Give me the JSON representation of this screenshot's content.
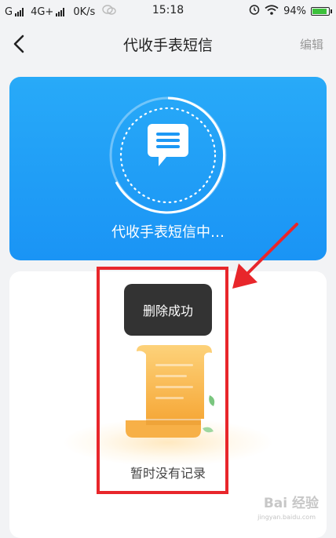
{
  "status_bar": {
    "carrier1": "G",
    "carrier2": "4G+",
    "speed": "0K/s",
    "time": "15:18",
    "battery": "94%",
    "battery_level": 0.94
  },
  "navbar": {
    "title": "代收手表短信",
    "edit_label": "编辑",
    "back_icon": "chevron-left-icon"
  },
  "hero": {
    "status_text": "代收手表短信中…",
    "icon": "message-icon",
    "color_top": "#28aaf8",
    "color_bottom": "#1a94f5"
  },
  "empty_state": {
    "text": "暂时没有记录",
    "icon": "empty-scroll-icon"
  },
  "toast": {
    "text": "删除成功"
  },
  "annotation": {
    "highlight_color": "#e8262b"
  },
  "watermark": {
    "text": "Bai 经验",
    "sub": "jingyan.baidu.com"
  }
}
